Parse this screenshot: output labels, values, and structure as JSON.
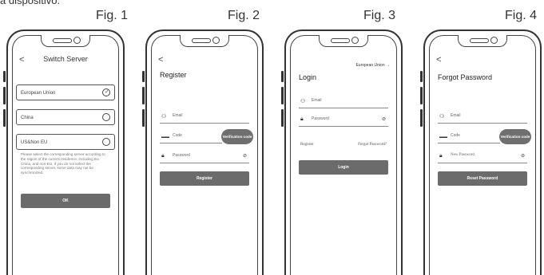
{
  "caption": "a dispositivo.",
  "figures": [
    "Fig. 1",
    "Fig. 2",
    "Fig. 3",
    "Fig. 4"
  ],
  "switch_server": {
    "back": "<",
    "title": "Switch Server",
    "options": [
      {
        "label": "European Union",
        "selected": true
      },
      {
        "label": "China",
        "selected": false
      },
      {
        "label": "US&Non EU",
        "selected": false
      }
    ],
    "notice": "Please select the corresponding server according to the region of the current residence, including Eu, China, and non-EU. If you do not select the corresponding server, some data may not be synchronized.",
    "ok": "OK"
  },
  "register": {
    "back": "<",
    "title": "Register",
    "email": "Email",
    "code": "Code",
    "verification": "Verification code",
    "password": "Password",
    "button": "Register"
  },
  "login": {
    "region": "European Union",
    "title": "Login",
    "email": "Email",
    "password": "Password",
    "register_link": "Register",
    "forgot_link": "Forgot Password?",
    "button": "Login"
  },
  "forgot": {
    "back": "<",
    "title": "Forgot Password",
    "email": "Email",
    "code": "Code",
    "verification": "Verification code",
    "new_password": "New Password",
    "button": "Reset Password"
  },
  "icons": {
    "user": "user-icon",
    "lock": "lock-icon",
    "code": "code-icon",
    "eye_off": "eye-off-icon",
    "check": "check-icon",
    "arrow_right": "arrow-right-icon"
  },
  "colors": {
    "button": "#6b6b6b",
    "outline": "#333333"
  }
}
